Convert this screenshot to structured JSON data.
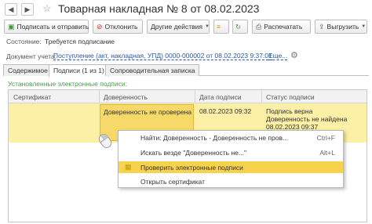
{
  "window": {
    "title": "Товарная накладная № 8 от 08.02.2023"
  },
  "toolbar": {
    "sign_send_label": "Подписать и отправить",
    "reject_label": "Отклонить",
    "other_actions_label": "Другие действия",
    "print_label": "Распечатать",
    "export_label": "Выгрузить"
  },
  "status": {
    "label": "Состояние:",
    "value": "Требуется подписание"
  },
  "document": {
    "label": "Документ учета:",
    "link": "Поступление (акт, накладная, УПД) 0000-000002 от 08.02.2023 9:37:01",
    "more": "Еще..."
  },
  "tabs": [
    {
      "label": "Содержимое"
    },
    {
      "label": "Подписи (1 из 1)"
    },
    {
      "label": "Сопроводительная записка"
    }
  ],
  "signatures": {
    "section_title": "Установленные электронные подписи:",
    "columns": [
      "Сертификат",
      "Доверенность",
      "Дата подписи",
      "Статус подписи"
    ],
    "row": {
      "certificate": "",
      "poa": "Доверенность не проверена",
      "date": "08.02.2023 09:32",
      "status_lines": [
        "Подпись верна",
        "Доверенность не найдена",
        "08.02.2023 09:37"
      ]
    }
  },
  "context_menu": {
    "items": [
      {
        "label": "Найти: Доверенность - Доверенность не пров...",
        "shortcut": "Ctrl+F"
      },
      {
        "label": "Искать везде \"Доверенность не...\"",
        "shortcut": "Alt+L"
      },
      {
        "label": "Проверить электронные подписи",
        "shortcut": ""
      },
      {
        "label": "Открыть сертификат",
        "shortcut": ""
      }
    ]
  },
  "colors": {
    "accent_yellow": "#f7d24c",
    "row_highlight": "#fcefa6",
    "link_blue": "#2a58a8",
    "section_green": "#4a9a4a"
  }
}
